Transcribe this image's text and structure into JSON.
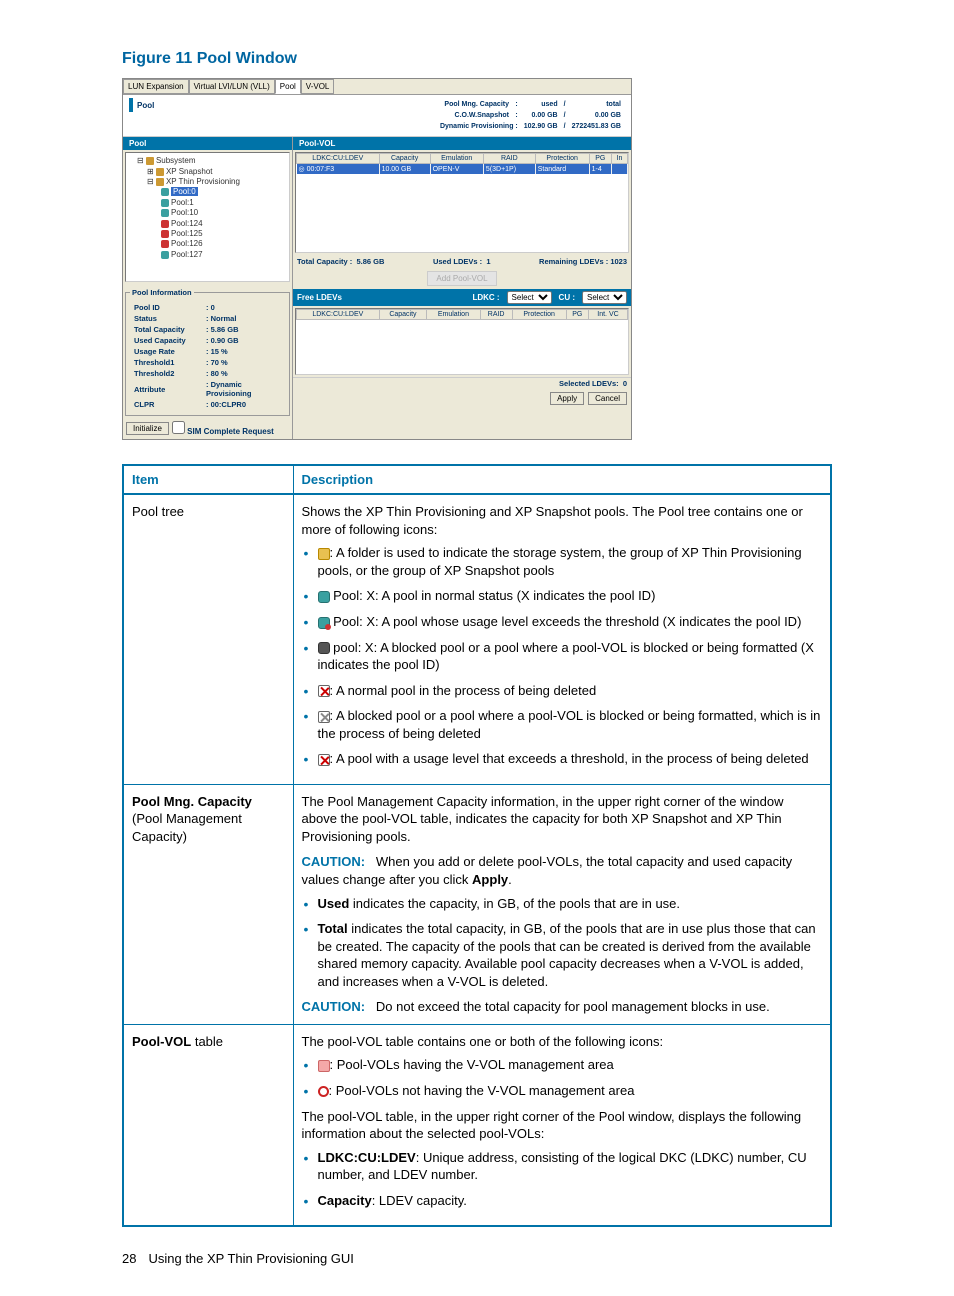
{
  "figure_title": "Figure 11 Pool Window",
  "screenshot": {
    "tabs": [
      "LUN Expansion",
      "Virtual LVI/LUN (VLL)",
      "Pool",
      "V-VOL"
    ],
    "active_tab": "Pool",
    "pool_title": "Pool",
    "mng": {
      "r1": {
        "lbl": "Pool Mng. Capacity",
        "sep": ":",
        "used": "used",
        "slash": "/",
        "total": "total"
      },
      "r2": {
        "lbl": "C.O.W.Snapshot",
        "sep": ":",
        "u": "0.00 GB",
        "slash": "/",
        "t": "0.00 GB"
      },
      "r3": {
        "lbl": "Dynamic Provisioning :",
        "u": "102.90 GB",
        "slash": "/",
        "t": "2722451.83 GB"
      }
    },
    "left": {
      "pool_bar": "Pool",
      "tree": {
        "root": "Subsystem",
        "n1": "XP Snapshot",
        "n2": "XP Thin Provisioning",
        "sel": "Pool:0",
        "c": [
          "Pool:1",
          "Pool:10",
          "Pool:124",
          "Pool:125",
          "Pool:126",
          "Pool:127"
        ]
      },
      "info": {
        "legend": "Pool Information",
        "rows": [
          [
            "Pool ID",
            ": 0"
          ],
          [
            "Status",
            ": Normal"
          ],
          [
            "Total Capacity",
            ": 5.86 GB"
          ],
          [
            "Used Capacity",
            ": 0.90 GB"
          ],
          [
            "Usage Rate",
            ": 15 %"
          ],
          [
            "Threshold1",
            ": 70 %"
          ],
          [
            "Threshold2",
            ": 80 %"
          ],
          [
            "Attribute",
            ": Dynamic Provisioning"
          ],
          [
            "CLPR",
            ": 00:CLPR0"
          ]
        ]
      },
      "init_btn": "Initialize",
      "sim_chk": "SIM Complete Request"
    },
    "right": {
      "poolvol_bar": "Pool-VOL",
      "cols1": [
        "LDKC:CU:LDEV",
        "Capacity",
        "Emulation",
        "RAID",
        "Protection",
        "PG",
        "In"
      ],
      "row1": [
        "00:07:F3",
        "10.00 GB",
        "OPEN-V",
        "5(3D+1P)",
        "Standard",
        "1-4",
        ""
      ],
      "stats": {
        "tc_lbl": "Total Capacity :",
        "tc": "5.86 GB",
        "ul_lbl": "Used LDEVs :",
        "ul": "1",
        "rl_lbl": "Remaining LDEVs :",
        "rl": "1023"
      },
      "add_btn": "Add Pool-VOL",
      "free": {
        "title": "Free LDEVs",
        "ldkc_lbl": "LDKC :",
        "ldkc_sel": "Select",
        "cu_lbl": "CU :",
        "cu_sel": "Select"
      },
      "cols2": [
        "LDKC:CU:LDEV",
        "Capacity",
        "Emulation",
        "RAID",
        "Protection",
        "PG",
        "Int. VC"
      ],
      "sel_lbl": "Selected LDEVs:",
      "sel_n": "0",
      "apply": "Apply",
      "cancel": "Cancel"
    }
  },
  "table": {
    "h1": "Item",
    "h2": "Description",
    "r1": {
      "item": "Pool tree",
      "intro": "Shows the XP Thin Provisioning and XP Snapshot pools. The Pool tree contains one or more of following icons:",
      "b1": ": A folder is used to indicate the storage system, the group of XP Thin Provisioning pools, or the group of XP Snapshot pools",
      "b2": " Pool: X: A pool in normal status (X indicates the pool ID)",
      "b3": " Pool: X: A pool whose usage level exceeds the threshold (X indicates the pool ID)",
      "b4": " pool: X: A blocked pool or a pool where a pool-VOL is blocked or being formatted (X indicates the pool ID)",
      "b5": ": A normal pool in the process of being deleted",
      "b6": ": A blocked pool or a pool where a pool-VOL is blocked or being formatted, which is in the process of being deleted",
      "b7": ": A pool with a usage level that exceeds a threshold, in the process of being deleted"
    },
    "r2": {
      "item1": "Pool Mng. Capacity",
      "item2": "(Pool Management Capacity)",
      "p1": "The Pool Management Capacity information, in the upper right corner of the window above the pool-VOL table, indicates the capacity for both XP Snapshot and XP Thin Provisioning pools.",
      "caution1_lbl": "CAUTION:",
      "caution1": "When you add or delete pool-VOLs, the total capacity and used capacity values change after you click ",
      "apply": "Apply",
      "b1a": "Used",
      "b1b": " indicates the capacity, in GB, of the pools that are in use.",
      "b2a": "Total",
      "b2b": " indicates the total capacity, in GB, of the pools that are in use plus those that can be created. The capacity of the pools that can be created is derived from the available shared memory capacity. Available pool capacity decreases when a V-VOL is added, and increases when a V-VOL is deleted.",
      "caution2_lbl": "CAUTION:",
      "caution2": "Do not exceed the total capacity for pool management blocks in use."
    },
    "r3": {
      "item": "Pool-VOL",
      "item2": " table",
      "p1": "The pool-VOL table contains one or both of the following icons:",
      "b1": ": Pool-VOLs having the V-VOL management area",
      "b2": ": Pool-VOLs not having the V-VOL management area",
      "p2": "The pool-VOL table, in the upper right corner of the Pool window, displays the following information about the selected pool-VOLs:",
      "b3a": "LDKC:CU:LDEV",
      "b3b": ": Unique address, consisting of the logical DKC (LDKC) number, CU number, and LDEV number.",
      "b4a": "Capacity",
      "b4b": ": LDEV capacity."
    }
  },
  "footer": {
    "page": "28",
    "chapter": "Using the XP Thin Provisioning GUI"
  }
}
